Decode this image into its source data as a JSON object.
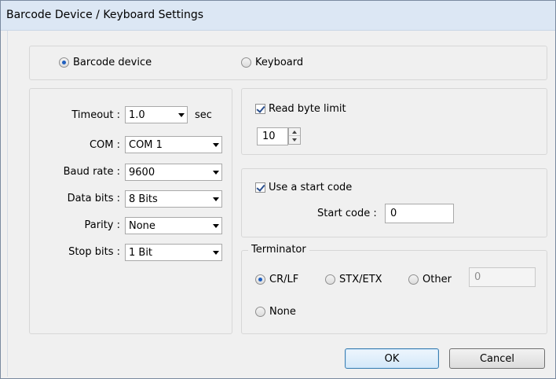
{
  "window": {
    "title": "Barcode Device / Keyboard Settings"
  },
  "mode": {
    "barcode_label": "Barcode device",
    "keyboard_label": "Keyboard",
    "selected": "barcode"
  },
  "settings": {
    "timeout_label": "Timeout :",
    "timeout_value": "1.0",
    "timeout_unit": "sec",
    "com_label": "COM :",
    "com_value": "COM 1",
    "baud_label": "Baud rate :",
    "baud_value": "9600",
    "databits_label": "Data bits :",
    "databits_value": "8 Bits",
    "parity_label": "Parity :",
    "parity_value": "None",
    "stopbits_label": "Stop bits :",
    "stopbits_value": "1 Bit"
  },
  "read_limit": {
    "label": "Read byte limit",
    "checked": true,
    "value": "10"
  },
  "start_code": {
    "checkbox_label": "Use a start code",
    "checked": true,
    "field_label": "Start code :",
    "value": "0"
  },
  "terminator": {
    "legend": "Terminator",
    "options": [
      "CR/LF",
      "STX/ETX",
      "Other",
      "None"
    ],
    "selected": "CR/LF",
    "other_value": "0"
  },
  "buttons": {
    "ok": "OK",
    "cancel": "Cancel"
  },
  "colors": {
    "titlebar": "#dce7f4",
    "dialog_bg": "#f0f0f0",
    "accent": "#1f5fbf"
  }
}
